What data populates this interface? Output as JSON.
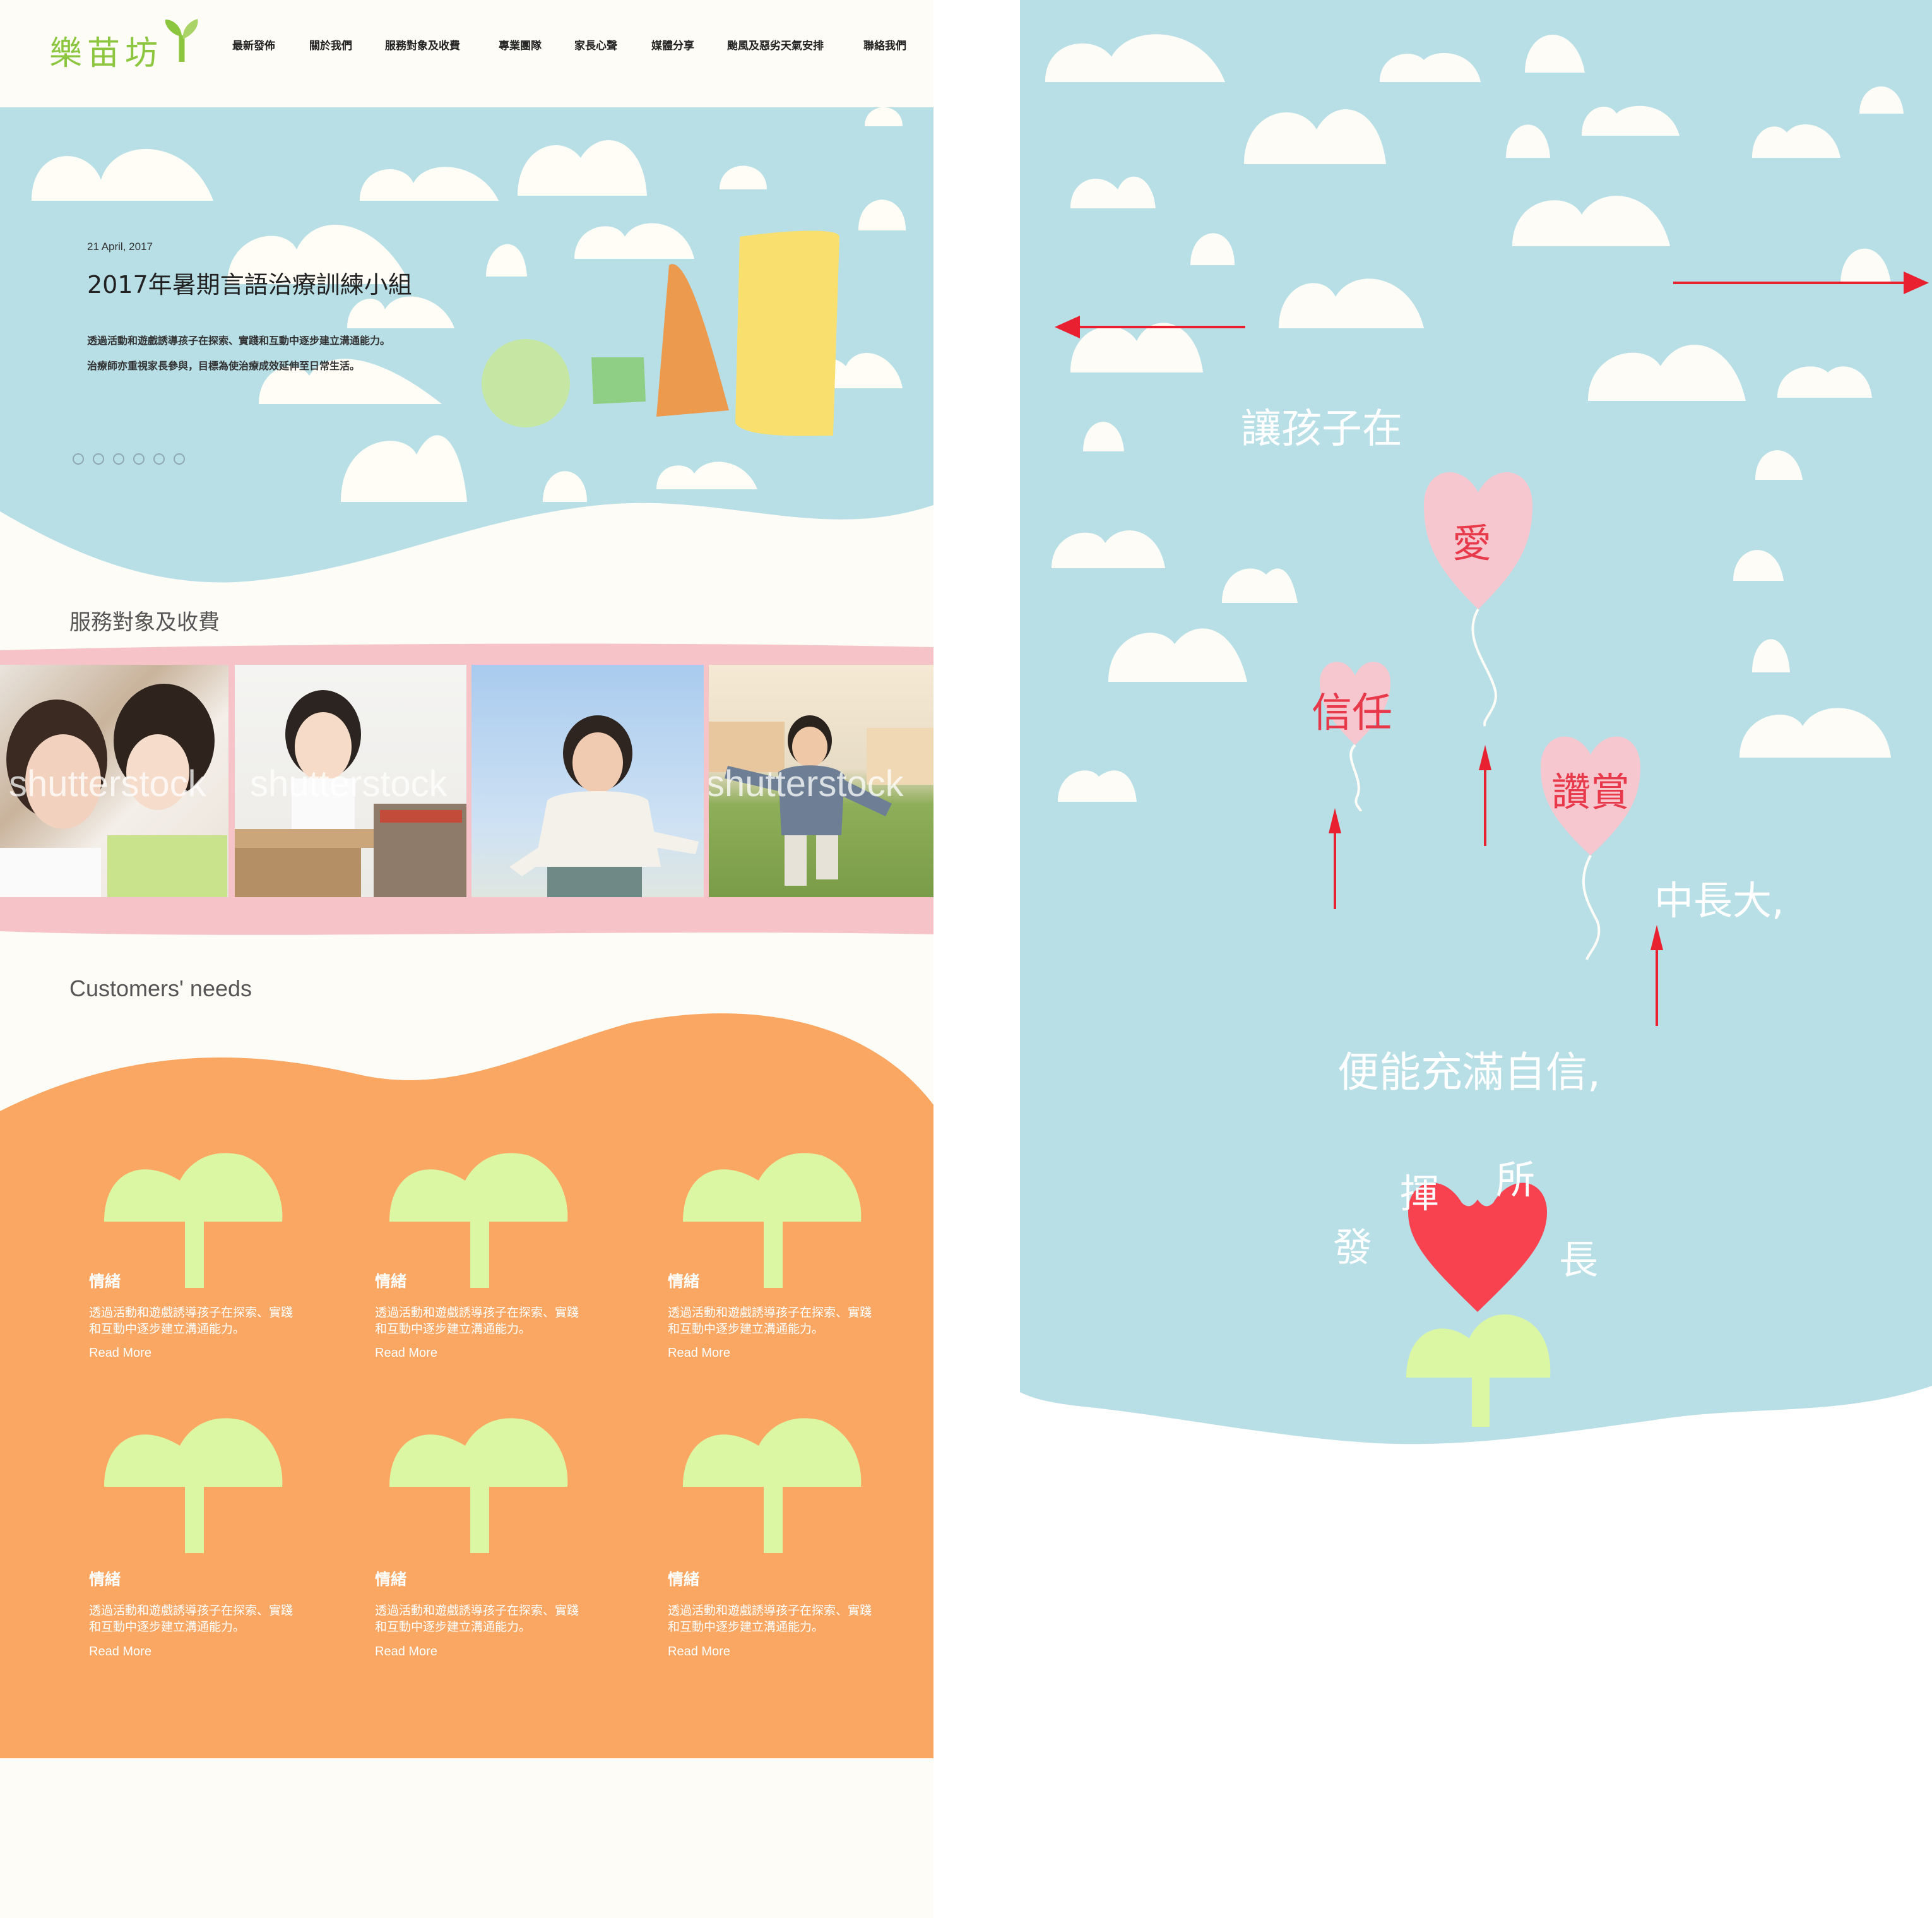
{
  "header": {
    "logo_text": "樂苗坊",
    "nav": [
      "最新發佈",
      "關於我們",
      "服務對象及收費",
      "專業團隊",
      "家長心聲",
      "媒體分享",
      "颱風及惡劣天氣安排",
      "聯絡我們"
    ]
  },
  "hero": {
    "date": "21 April, 2017",
    "title": "2017年暑期言語治療訓練小組",
    "desc_line1": "透過活動和遊戲誘導孩子在探索、實踐和互動中逐步建立溝通能力。",
    "desc_line2": "治療師亦重視家長參與，目標為使治療成效延伸至日常生活。",
    "slides_count": 6
  },
  "services": {
    "title": "服務對象及收費",
    "photos": [
      {
        "watermark": "shutterstock",
        "alt": "mother and daughter whispering"
      },
      {
        "watermark": "shutterstock",
        "alt": "girl with books"
      },
      {
        "watermark": "",
        "alt": "girl jumping outdoors"
      },
      {
        "watermark": "shutterstock",
        "alt": "boy running in park"
      }
    ]
  },
  "needs": {
    "title": "Customers' needs",
    "cards": [
      {
        "title": "情緒",
        "desc": "透過活動和遊戲誘導孩子在探索、實踐和互動中逐步建立溝通能力。",
        "more": "Read More"
      },
      {
        "title": "情緒",
        "desc": "透過活動和遊戲誘導孩子在探索、實踐和互動中逐步建立溝通能力。",
        "more": "Read More"
      },
      {
        "title": "情緒",
        "desc": "透過活動和遊戲誘導孩子在探索、實踐和互動中逐步建立溝通能力。",
        "more": "Read More"
      },
      {
        "title": "情緒",
        "desc": "透過活動和遊戲誘導孩子在探索、實踐和互動中逐步建立溝通能力。",
        "more": "Read More"
      },
      {
        "title": "情緒",
        "desc": "透過活動和遊戲誘導孩子在探索、實踐和互動中逐步建立溝通能力。",
        "more": "Read More"
      },
      {
        "title": "情緒",
        "desc": "透過活動和遊戲誘導孩子在探索、實踐和互動中逐步建立溝通能力。",
        "more": "Read More"
      }
    ]
  },
  "concept": {
    "line1": "讓孩子在",
    "heart_love": "愛",
    "heart_trust": "信任",
    "heart_praise": "讚賞",
    "line2": "中長大,",
    "line3": "便能充滿自信,",
    "arc_1": "發",
    "arc_2": "揮",
    "arc_3": "所",
    "arc_4": "長"
  },
  "colors": {
    "sky": "#b8dfe6",
    "cream": "#fefcf6",
    "pink_band": "#f6c4c8",
    "orange": "#fba764",
    "sprout": "#dcf7a3",
    "logo_green": "#8cc63f",
    "heart_red": "#f84250",
    "arrow_red": "#e8202f"
  }
}
